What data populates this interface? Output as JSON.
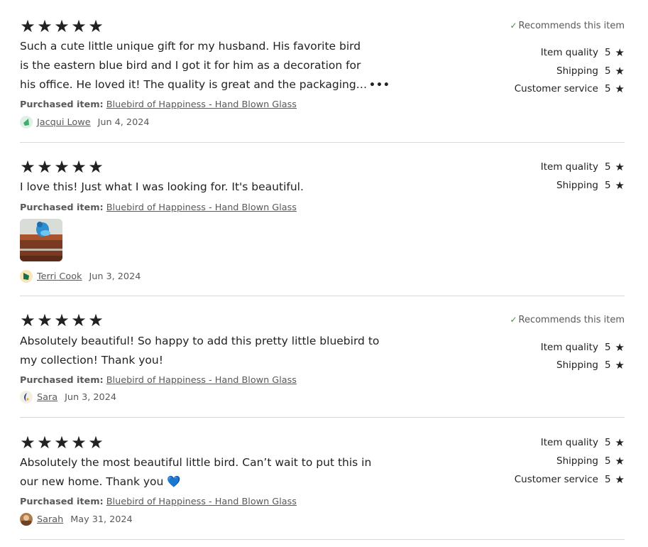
{
  "reviews": [
    {
      "stars": 5,
      "text": "Such a cute little unique gift for my husband. His favorite bird is the eastern blue bird and I got it for him as a decoration for his office. He loved it! The quality is great and the packaging was nice.",
      "more_label": "•••",
      "purchased_label": "Purchased item:",
      "item_link": "Bluebird of Happiness - Hand Blown Glass",
      "reviewer": "Jacqui Lowe",
      "date": "Jun 4, 2024",
      "recommends": "Recommends this item",
      "ratings": [
        {
          "label": "Item quality",
          "value": "5"
        },
        {
          "label": "Shipping",
          "value": "5"
        },
        {
          "label": "Customer service",
          "value": "5"
        }
      ]
    },
    {
      "stars": 5,
      "text": "I love this! Just what I was looking for. It's beautiful.",
      "purchased_label": "Purchased item:",
      "item_link": "Bluebird of Happiness - Hand Blown Glass",
      "reviewer": "Terri Cook",
      "date": "Jun 3, 2024",
      "ratings": [
        {
          "label": "Item quality",
          "value": "5"
        },
        {
          "label": "Shipping",
          "value": "5"
        }
      ]
    },
    {
      "stars": 5,
      "text": "Absolutely beautiful! So happy to add this pretty little bluebird to my collection! Thank you!",
      "purchased_label": "Purchased item:",
      "item_link": "Bluebird of Happiness - Hand Blown Glass",
      "reviewer": "Sara",
      "date": "Jun 3, 2024",
      "recommends": "Recommends this item",
      "ratings": [
        {
          "label": "Item quality",
          "value": "5"
        },
        {
          "label": "Shipping",
          "value": "5"
        }
      ]
    },
    {
      "stars": 5,
      "text": "Absolutely the most beautiful little bird. Can’t wait to put this in our new home. Thank you 💙",
      "purchased_label": "Purchased item:",
      "item_link": "Bluebird of Happiness - Hand Blown Glass",
      "reviewer": "Sarah",
      "date": "May 31, 2024",
      "ratings": [
        {
          "label": "Item quality",
          "value": "5"
        },
        {
          "label": "Shipping",
          "value": "5"
        },
        {
          "label": "Customer service",
          "value": "5"
        }
      ]
    }
  ],
  "colors": {
    "text": "#222222",
    "muted": "#595959",
    "divider": "#d9d9d9",
    "check": "#3f8f4f"
  },
  "icons": {
    "star": "star-icon",
    "check": "check-icon",
    "more": "more-dots-icon"
  }
}
